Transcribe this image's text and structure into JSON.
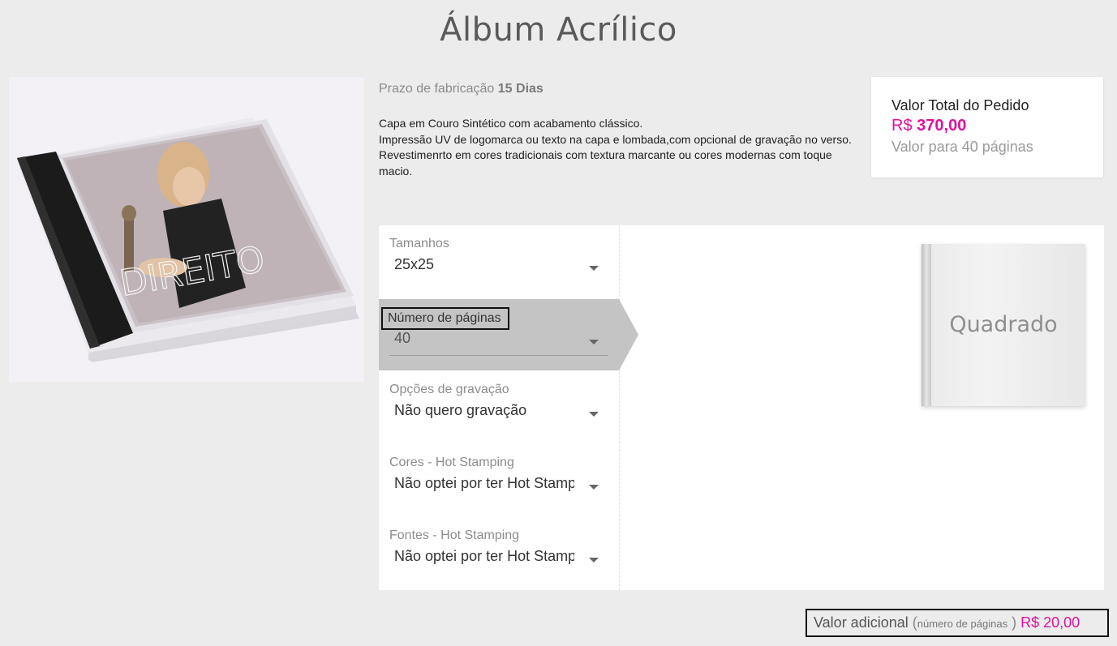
{
  "page": {
    "title": "Álbum Acrílico"
  },
  "product": {
    "lead_time_label": "Prazo de fabricação",
    "lead_time_value": "15 Dias",
    "description": [
      "Capa em Couro Sintético com acabamento clássico.",
      "Impressão UV de logomarca ou texto na capa e lombada,com opcional de gravação no verso.",
      "Revestimenrto em cores tradicionais com textura marcante ou cores modernas com toque macio."
    ]
  },
  "total": {
    "title": "Valor Total do Pedido",
    "currency": "R$",
    "amount": "370,00",
    "pages_note": "Valor para 40 páginas"
  },
  "options": [
    {
      "label": "Tamanhos",
      "value": "25x25"
    },
    {
      "label": "Número de páginas",
      "value": "40"
    },
    {
      "label": "Opções de gravação",
      "value": "Não quero gravação"
    },
    {
      "label": "Cores - Hot Stamping",
      "value": "Não optei por ter Hot Stamping"
    },
    {
      "label": "Fontes - Hot Stamping",
      "value": "Não optei por ter Hot Stamping"
    }
  ],
  "preview": {
    "label": "Quadrado"
  },
  "extra": {
    "label": "Valor adicional",
    "open_paren": "(",
    "detail": "número de páginas",
    "close_paren": ")",
    "price": "R$ 20,00"
  },
  "colors": {
    "accent": "#e0119c",
    "background": "#ececec",
    "active_option": "#c4c4c4"
  }
}
